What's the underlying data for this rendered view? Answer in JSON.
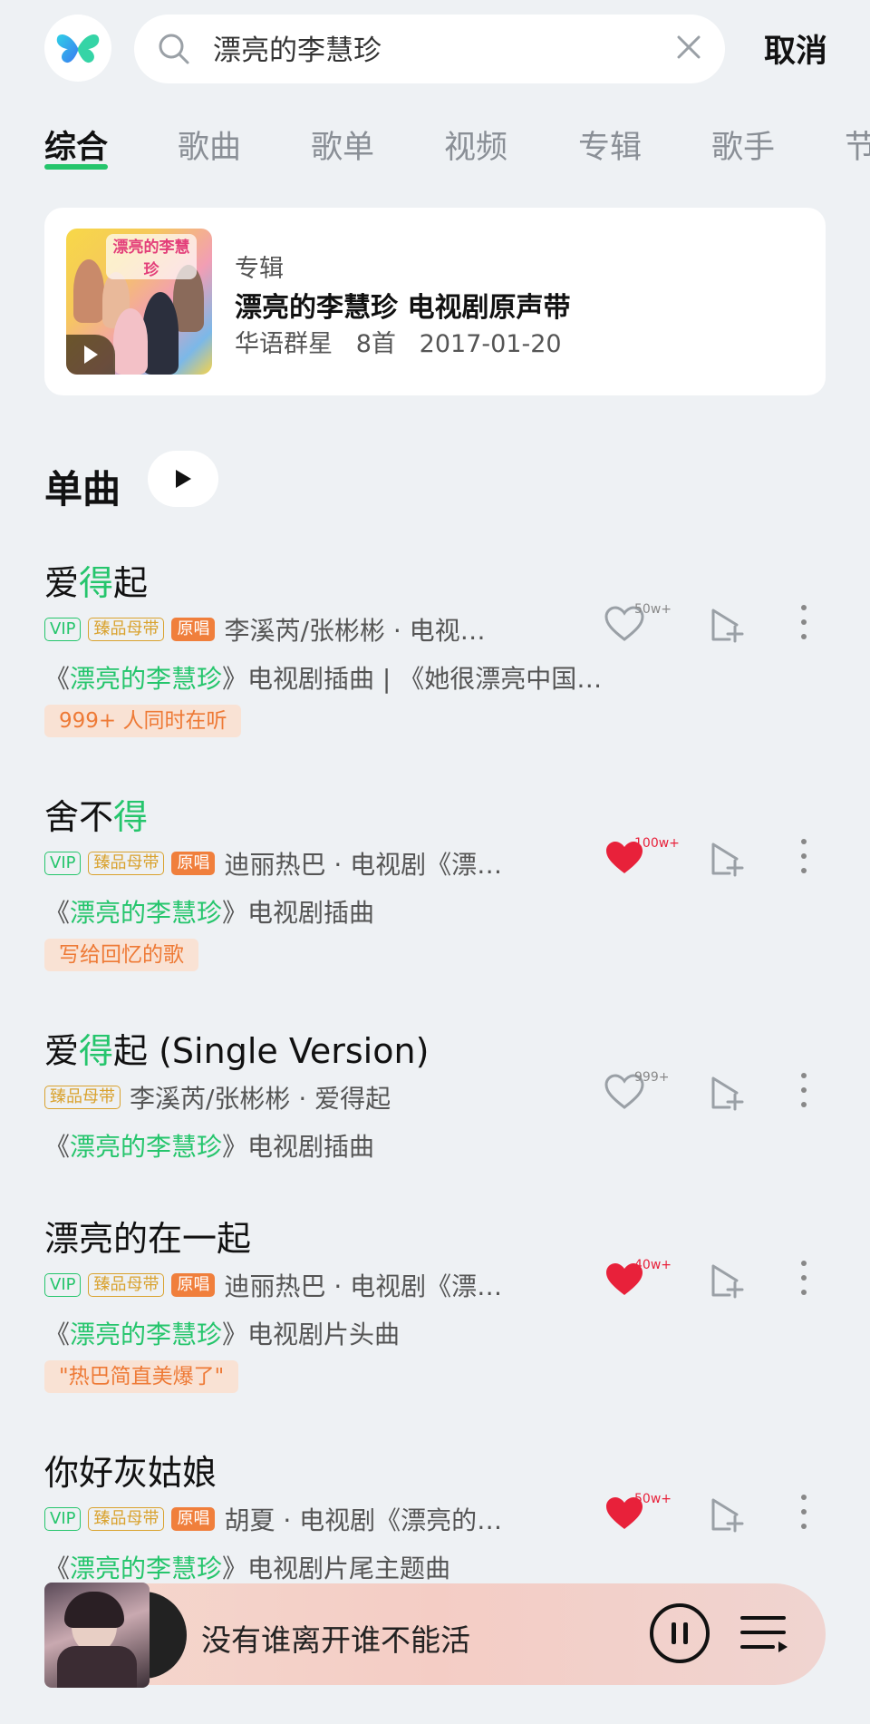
{
  "search": {
    "query": "漂亮的李慧珍",
    "cancel_label": "取消"
  },
  "tabs": [
    "综合",
    "歌曲",
    "歌单",
    "视频",
    "专辑",
    "歌手",
    "节"
  ],
  "album_card": {
    "type": "专辑",
    "title": "漂亮的李慧珍 电视剧原声带",
    "meta": "华语群星   8首   2017-01-20",
    "cover_text": "漂亮的李慧珍"
  },
  "singles": {
    "title": "单曲"
  },
  "songs": [
    {
      "title_pre": "爱",
      "title_hl": "得",
      "title_post": "起",
      "tags": {
        "vip": "VIP",
        "mudai": "臻品母带",
        "yuanchang": "原唱"
      },
      "artist": "李溪芮/张彬彬 · 电视…",
      "desc_pre": "《",
      "desc_hl": "漂亮的李慧珍",
      "desc_post": "》电视剧插曲 | 《她很漂亮中国…",
      "badge": "999+ 人同时在听",
      "like_count": "50w+",
      "liked": false
    },
    {
      "title_pre": "舍不",
      "title_hl": "得",
      "title_post": "",
      "tags": {
        "vip": "VIP",
        "mudai": "臻品母带",
        "yuanchang": "原唱"
      },
      "artist": "迪丽热巴 · 电视剧《漂…",
      "desc_pre": "《",
      "desc_hl": "漂亮的李慧珍",
      "desc_post": "》电视剧插曲",
      "badge": "写给回忆的歌",
      "like_count": "100w+",
      "liked": true
    },
    {
      "title_pre": "爱",
      "title_hl": "得",
      "title_post": "起 (Single Version)",
      "tags": {
        "mudai": "臻品母带"
      },
      "artist": "李溪芮/张彬彬 · 爱得起",
      "desc_pre": "《",
      "desc_hl": "漂亮的李慧珍",
      "desc_post": "》电视剧插曲",
      "like_count": "999+",
      "liked": false
    },
    {
      "title_pre": "漂亮的在一起",
      "title_hl": "",
      "title_post": "",
      "tags": {
        "vip": "VIP",
        "mudai": "臻品母带",
        "yuanchang": "原唱"
      },
      "artist": "迪丽热巴 · 电视剧《漂…",
      "desc_pre": "《",
      "desc_hl": "漂亮的李慧珍",
      "desc_post": "》电视剧片头曲",
      "badge": "\"热巴简直美爆了\"",
      "like_count": "40w+",
      "liked": true
    },
    {
      "title_pre": "你好灰姑娘",
      "title_hl": "",
      "title_post": "",
      "tags": {
        "vip": "VIP",
        "mudai": "臻品母带",
        "yuanchang": "原唱"
      },
      "artist": "胡夏 · 电视剧《漂亮的…",
      "desc_pre": "《",
      "desc_hl": "漂亮的李慧珍",
      "desc_post": "》电视剧片尾主题曲",
      "like_count": "50w+",
      "liked": true
    }
  ],
  "now_playing": {
    "title": "没有谁离开谁不能活"
  },
  "colors": {
    "accent": "#25c56c",
    "like": "#e8213a",
    "badge_text": "#ee7a36"
  }
}
